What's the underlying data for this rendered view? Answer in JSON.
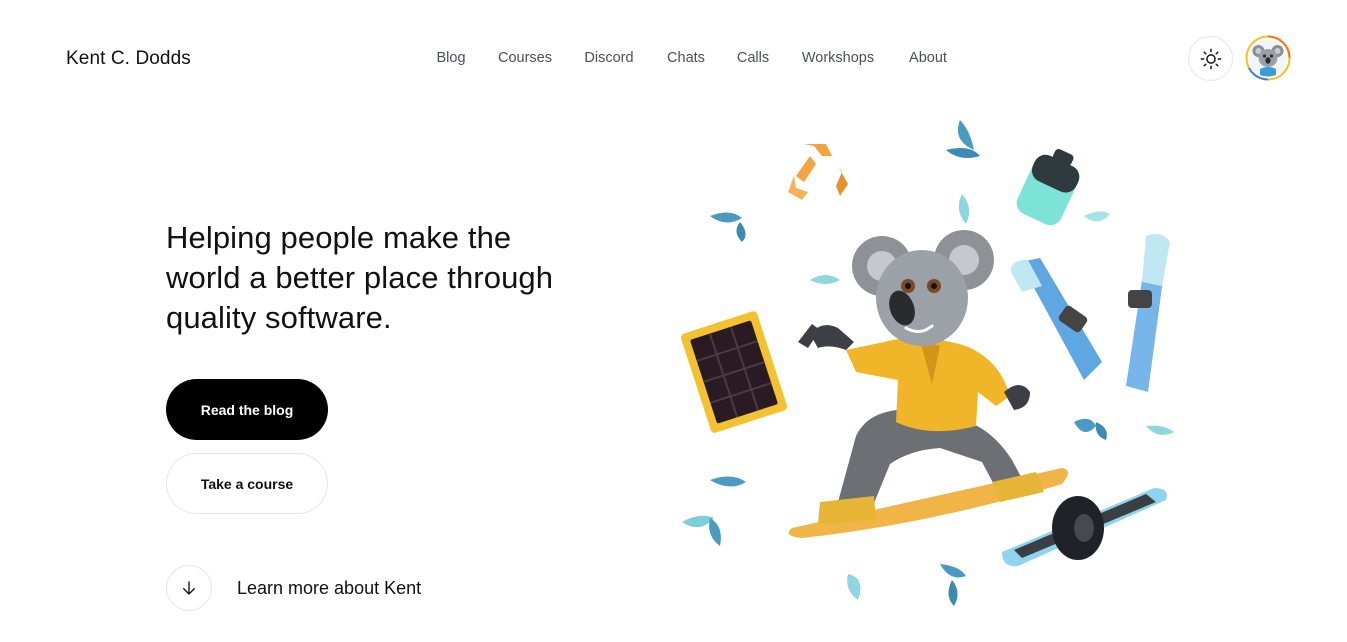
{
  "header": {
    "brand": "Kent C. Dodds",
    "nav": [
      {
        "label": "Blog"
      },
      {
        "label": "Courses"
      },
      {
        "label": "Discord"
      },
      {
        "label": "Chats"
      },
      {
        "label": "Calls"
      },
      {
        "label": "Workshops"
      },
      {
        "label": "About"
      }
    ],
    "theme_toggle_icon": "sun-icon",
    "avatar_icon": "koala-avatar"
  },
  "hero": {
    "headline": "Helping people make the world a better place through quality software.",
    "primary_cta": "Read the blog",
    "secondary_cta": "Take a course",
    "learn_more": "Learn more about Kent",
    "learn_more_icon": "arrow-down-icon",
    "illustration": "koala-snowboarding-illustration"
  },
  "colors": {
    "primary_button_bg": "#000000",
    "border": "#e5e7eb",
    "nav_text": "#4b4f56",
    "avatar_ring": [
      "#f97316",
      "#3b82f6",
      "#fbbf24"
    ]
  }
}
